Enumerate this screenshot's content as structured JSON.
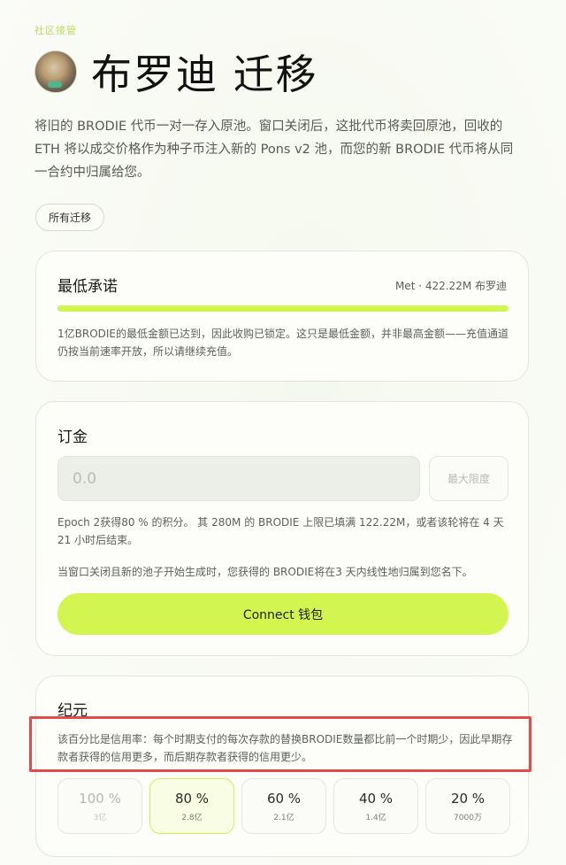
{
  "kicker": "社区接管",
  "title": "布罗迪 迁移",
  "description": "将旧的 BRODIE 代币一对一存入原池。窗口关闭后，这批代币将卖回原池，回收的 ETH 将以成交价格作为种子币注入新的 Pons v2 池，而您的新 BRODIE 代币将从同一合约中归属给您。",
  "all_migrations_label": "所有迁移",
  "minimum": {
    "heading": "最低承诺",
    "met_text": "Met · 422.22M 布罗迪",
    "progress_fraction": 1.0,
    "note": "1亿BRODIE的最低金额已达到，因此收购已锁定。这只是最低金额，并非最高金额——充值通道仍按当前速率开放，所以请继续充值。"
  },
  "deposit": {
    "heading": "订金",
    "input_placeholder": "0.0",
    "max_label": "最大限度",
    "epoch_text": "Epoch 2获得80 % 的积分。 其 280M 的 BRODIE 上限已填满 122.22M，或者该轮将在 4 天 21 小时后结束。",
    "vest_text": "当窗口关闭且新的池子开始生成时，您获得的 BRODIE将在3 天内线性地归属到您名下。",
    "connect_label": "Connect 钱包"
  },
  "era": {
    "heading": "纪元",
    "note": "该百分比是信用率：每个时期支付的每次存款的替换BRODIE数量都比前一个时期少，因此早期存款者获得的信用更多，而后期存款者获得的信用更少。",
    "epochs": [
      {
        "pct": "100 %",
        "amount": "3亿",
        "state": "past"
      },
      {
        "pct": "80 %",
        "amount": "2.8亿",
        "state": "active"
      },
      {
        "pct": "60 %",
        "amount": "2.1亿",
        "state": "future"
      },
      {
        "pct": "40 %",
        "amount": "1.4亿",
        "state": "future"
      },
      {
        "pct": "20 %",
        "amount": "7000万",
        "state": "future"
      }
    ]
  },
  "colors": {
    "accent": "#d3f54f",
    "highlight_border": "#e04b4b"
  }
}
